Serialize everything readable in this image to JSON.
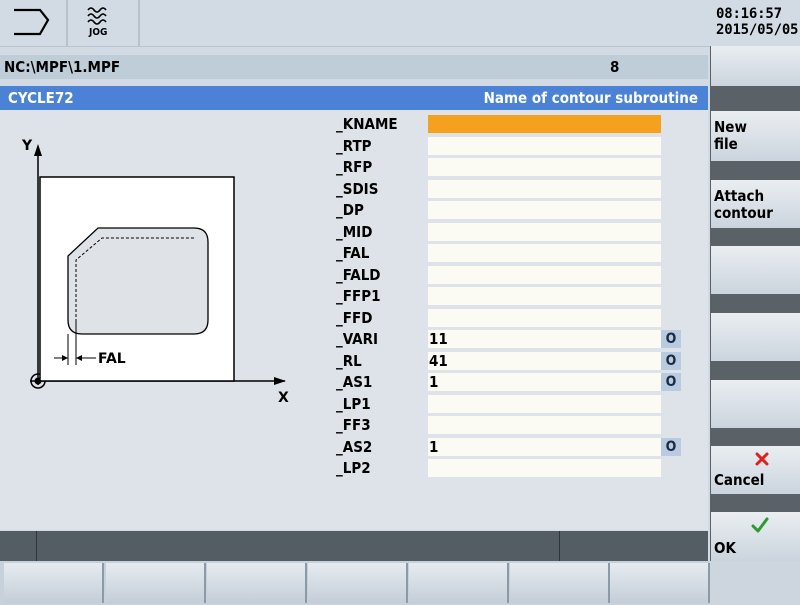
{
  "header": {
    "mode_label": "JOG",
    "time": "08:16:57",
    "date": "2015/05/05"
  },
  "path": {
    "file": "NC:\\MPF\\1.MPF",
    "block": "8"
  },
  "cycle": {
    "title": "CYCLE72",
    "description": "Name of contour subroutine"
  },
  "diagram": {
    "y_axis": "Y",
    "x_axis": "X",
    "fal_label": "FAL"
  },
  "params": [
    {
      "label": "_KNAME",
      "value": ""
    },
    {
      "label": "_RTP",
      "value": ""
    },
    {
      "label": "_RFP",
      "value": ""
    },
    {
      "label": "_SDIS",
      "value": ""
    },
    {
      "label": "_DP",
      "value": ""
    },
    {
      "label": "_MID",
      "value": ""
    },
    {
      "label": "_FAL",
      "value": ""
    },
    {
      "label": "_FALD",
      "value": ""
    },
    {
      "label": "_FFP1",
      "value": ""
    },
    {
      "label": "_FFD",
      "value": ""
    },
    {
      "label": "_VARI",
      "value": "11"
    },
    {
      "label": "_RL",
      "value": "41"
    },
    {
      "label": "_AS1",
      "value": "1"
    },
    {
      "label": "_LP1",
      "value": ""
    },
    {
      "label": "_FF3",
      "value": ""
    },
    {
      "label": "_AS2",
      "value": "1"
    },
    {
      "label": "_LP2",
      "value": ""
    }
  ],
  "toggle_glyph": "O",
  "softkeys": {
    "new_file": [
      "New",
      "file"
    ],
    "attach_contour": [
      "Attach",
      "contour"
    ],
    "cancel": "Cancel",
    "ok": "OK"
  },
  "colors": {
    "active_field": "#f3a11f",
    "header_blue": "#4b82d6",
    "cancel_red": "#e0201a",
    "ok_green": "#2e9a2e"
  }
}
